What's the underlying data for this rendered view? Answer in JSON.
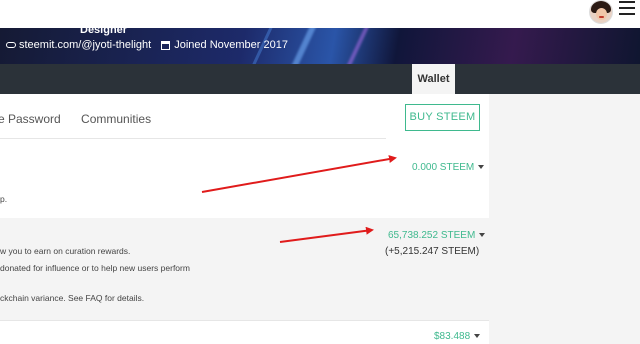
{
  "header": {
    "designer_text": "Designer",
    "profile_link": "steemit.com/@jyoti-thelight",
    "joined": "Joined November 2017",
    "icons": [
      "link-icon",
      "calendar-icon",
      "avatar",
      "hamburger-menu-icon"
    ]
  },
  "nav": {
    "wallet_tab": "Wallet"
  },
  "subtabs": [
    "e Password",
    "Communities"
  ],
  "buy_button": "BUY STEEM",
  "steem": {
    "amount": "0.000 STEEM",
    "desc": "p."
  },
  "steem_power": {
    "amount": "65,738.252 STEEM",
    "delegated": "(+5,215.247 STEEM)",
    "desc_lines": [
      "w you to earn on curation rewards.",
      "donated for influence or to help new users perform",
      "",
      "ckchain variance. See FAQ for details."
    ]
  },
  "steem_dollars": {
    "amount": "$83.488"
  },
  "colors": {
    "accent": "#3fb98e",
    "navbar": "#2b3239",
    "annotation_arrow": "#e01b1b"
  }
}
